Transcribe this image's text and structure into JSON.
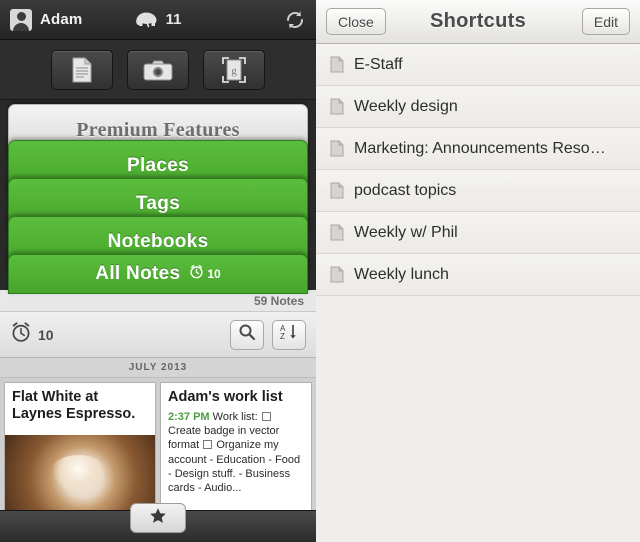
{
  "left_pane": {
    "topbar": {
      "user_name": "Adam",
      "elephant_icon": "elephant-icon",
      "note_count": "11",
      "sync_icon": "sync-icon",
      "avatar_icon": "avatar-icon"
    },
    "quick_actions": [
      {
        "name": "new-text-note-button",
        "icon": "document-icon"
      },
      {
        "name": "new-photo-note-button",
        "icon": "camera-icon"
      },
      {
        "name": "new-page-camera-button",
        "icon": "page-camera-icon"
      }
    ],
    "tabs": [
      {
        "label": "Premium Features",
        "name": "tab-premium-features"
      },
      {
        "label": "Places",
        "name": "tab-places"
      },
      {
        "label": "Tags",
        "name": "tab-tags"
      },
      {
        "label": "Notebooks",
        "name": "tab-notebooks"
      },
      {
        "label": "All Notes",
        "name": "tab-all-notes",
        "badge": "10",
        "badge_icon": "reminder-clock-icon"
      }
    ],
    "notes_count_label": "59 Notes",
    "toolbar": {
      "reminder_icon": "reminder-clock-icon",
      "reminder_count": "10",
      "search_icon": "search-icon",
      "sort_icon": "sort-az-icon"
    },
    "date_header": "JULY 2013",
    "note_cards": [
      {
        "name": "note-card-photo",
        "title": "Flat White at Laynes Espresso.",
        "has_photo": true
      },
      {
        "name": "note-card-work-list",
        "title": "Adam's work list",
        "time": "2:37 PM",
        "body_part1": "Work list:",
        "body_part2": "Create badge in vector format",
        "body_part3": "Organize my account - Education - Food - Design stuff. - Business cards - Audio..."
      }
    ],
    "bottom_bar": {
      "star_icon": "star-icon"
    }
  },
  "right_pane": {
    "header": {
      "close_label": "Close",
      "title": "Shortcuts",
      "edit_label": "Edit"
    },
    "shortcuts": [
      {
        "label": "E-Staff",
        "icon": "note-icon"
      },
      {
        "label": "Weekly design",
        "icon": "note-icon"
      },
      {
        "label": "Marketing: Announcements Reso…",
        "icon": "note-icon"
      },
      {
        "label": "podcast topics",
        "icon": "note-icon"
      },
      {
        "label": "Weekly w/ Phil",
        "icon": "note-icon"
      },
      {
        "label": "Weekly lunch",
        "icon": "note-icon"
      }
    ]
  },
  "colors": {
    "evernote_green": "#4fb02d",
    "dark_chrome": "#2a2a2a",
    "ios_list_bg": "#efeeea",
    "accent_time": "#4a9d3f"
  }
}
